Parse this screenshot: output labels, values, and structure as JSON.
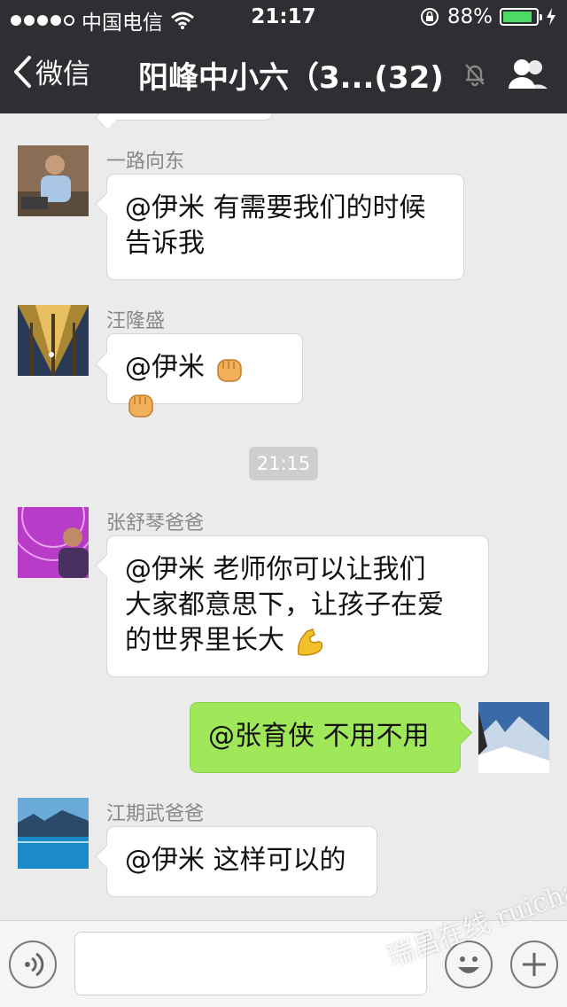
{
  "status_bar": {
    "carrier": "中国电信",
    "time": "21:17",
    "battery": "88%",
    "battery_level": 0.88
  },
  "nav": {
    "back_label": "微信",
    "title": "阳峰中小六（3...(32)",
    "icons": [
      "chevron-left-icon",
      "mute-bell-icon",
      "group-members-icon"
    ]
  },
  "messages": [
    {
      "sender": "一路向东",
      "line1": "@伊米 有需要我们的时候",
      "line2": "告诉我"
    },
    {
      "sender": "汪隆盛",
      "line1": "@伊米",
      "emoji": "fist-emoji"
    },
    {
      "timestamp": "21:15"
    },
    {
      "sender": "张舒琴爸爸",
      "line1": "@伊米 老师你可以让我们",
      "line2": "大家都意思下，让孩子在爱",
      "line3": "的世界里长大",
      "emoji": "flexed-biceps-emoji"
    },
    {
      "outgoing": true,
      "line1": "@张育侠 不用不用"
    },
    {
      "sender": "江期武爸爸",
      "line1": "@伊米 这样可以的"
    }
  ],
  "watermark": "瑞昌在线 ruichang.org",
  "colors": {
    "nav_bg": "#2e2e33",
    "chat_bg": "#ebebeb",
    "outgoing_bubble": "#a0e75a",
    "incoming_bubble": "#ffffff",
    "battery_fill": "#4cd964"
  }
}
